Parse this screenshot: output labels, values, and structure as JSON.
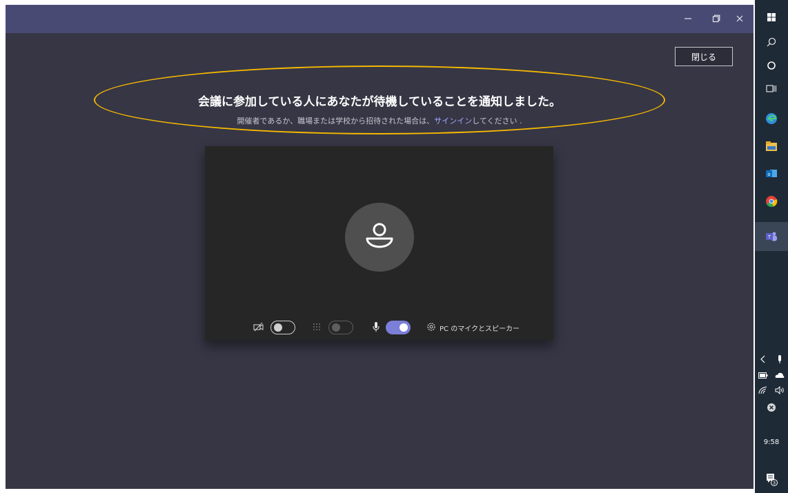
{
  "window": {
    "minimize_icon": "minimize-icon",
    "maximize_icon": "maximize-icon",
    "close_icon": "close-icon"
  },
  "close_button": {
    "label": "閉じる"
  },
  "notice": {
    "headline": "会議に参加している人にあなたが待機していることを通知しました。",
    "sub_prefix": "開催者であるか、職場または学校から招待された場合は、",
    "sub_link": "サインイン",
    "sub_suffix": "してください ."
  },
  "preview": {
    "avatar_icon": "person-icon",
    "camera": {
      "icon": "camera-off-icon",
      "on": false
    },
    "background_blur": {
      "icon": "blur-icon",
      "on": false,
      "enabled": false
    },
    "microphone": {
      "icon": "microphone-icon",
      "on": true
    },
    "device_settings": {
      "icon": "gear-icon",
      "label": "PC のマイクとスピーカー"
    }
  },
  "taskbar": {
    "icons": [
      "windows-start-icon",
      "search-icon",
      "cortana-icon",
      "task-view-icon",
      "edge-icon",
      "file-explorer-icon",
      "outlook-icon",
      "chrome-icon",
      "teams-icon"
    ],
    "tray_icons": [
      "chevron-left-icon",
      "microphone-icon",
      "battery-icon",
      "onedrive-icon",
      "wifi-icon",
      "volume-icon",
      "notification-off-icon"
    ],
    "clock": "9:58",
    "notification_count": "3"
  },
  "colors": {
    "title_bar": "#494a74",
    "app_background": "#363645",
    "video_background": "#262626",
    "accent": "#7b7fd8",
    "highlight_oval": "#f5b800",
    "taskbar": "#1f2a37"
  }
}
